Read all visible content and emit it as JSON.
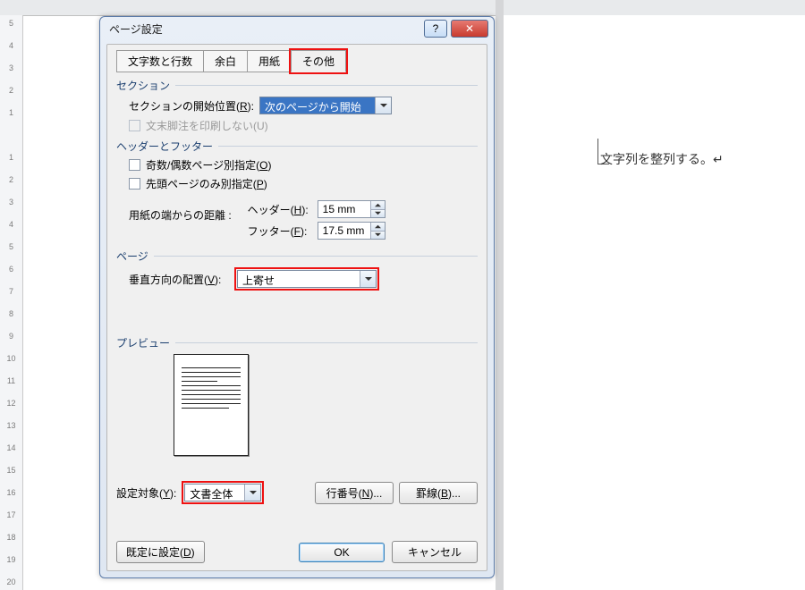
{
  "dialog": {
    "title": "ページ設定",
    "tabs": [
      "文字数と行数",
      "余白",
      "用紙",
      "その他"
    ],
    "active_tab": 3
  },
  "section": {
    "group": "セクション",
    "start_label": "セクションの開始位置(",
    "start_key": "R",
    "start_value": "次のページから開始",
    "suppress_endnote_label": "文末脚注を印刷しない(U)"
  },
  "hf": {
    "group": "ヘッダーとフッター",
    "odd_even_label": "奇数/偶数ページ別指定(",
    "odd_even_key": "O",
    "first_page_label": "先頭ページのみ別指定(",
    "first_page_key": "P",
    "edge_label": "用紙の端からの距離 :",
    "header_label": "ヘッダー(",
    "header_key": "H",
    "header_value": "15 mm",
    "footer_label": "フッター(",
    "footer_key": "F",
    "footer_value": "17.5 mm"
  },
  "page": {
    "group": "ページ",
    "valign_label": "垂直方向の配置(",
    "valign_key": "V",
    "valign_value": "上寄せ"
  },
  "preview": {
    "group": "プレビュー"
  },
  "apply": {
    "label": "設定対象(",
    "key": "Y",
    "value": "文書全体",
    "linenum_btn": "行番号(",
    "linenum_key": "N",
    "border_btn": "罫線(",
    "border_key": "B"
  },
  "buttons": {
    "default": "既定に設定(",
    "default_key": "D",
    "ok": "OK",
    "cancel": "キャンセル"
  },
  "doc_text": "文字列を整列する。↵",
  "ruler_numbers": [
    "5",
    "4",
    "3",
    "2",
    "1",
    "",
    "1",
    "2",
    "3",
    "4",
    "5",
    "6",
    "7",
    "8",
    "9",
    "10",
    "11",
    "12",
    "13",
    "14",
    "15",
    "16",
    "17",
    "18",
    "19",
    "20"
  ],
  "colors": {
    "highlight": "#e11"
  }
}
